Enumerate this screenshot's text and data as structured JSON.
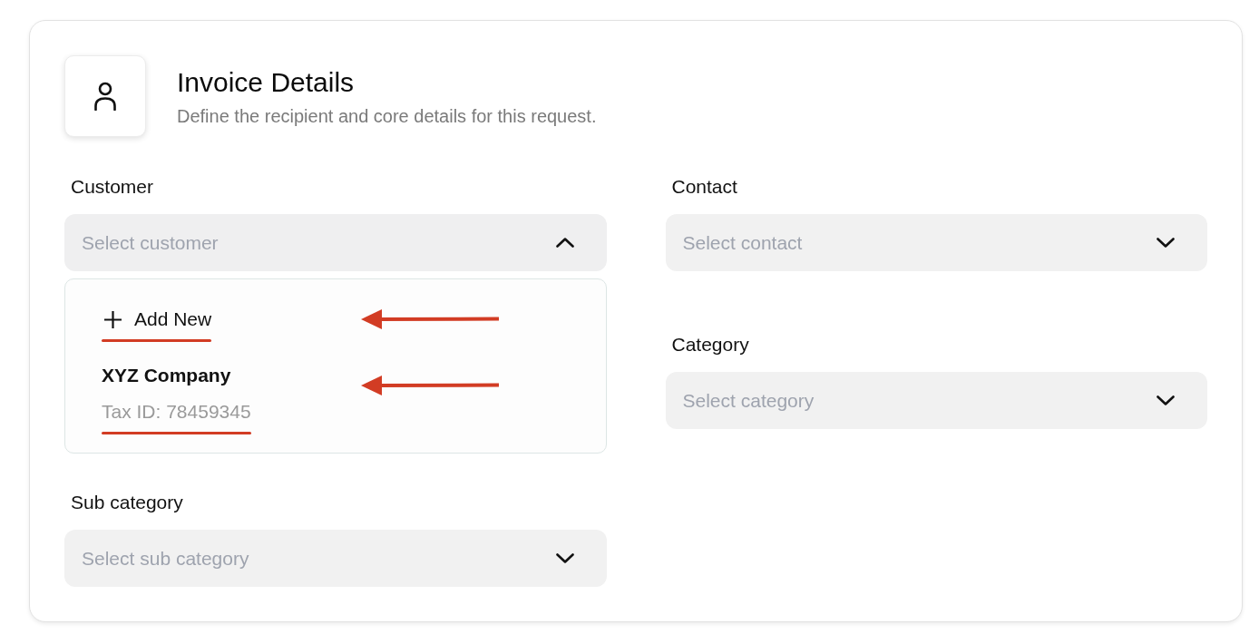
{
  "header": {
    "title": "Invoice Details",
    "subtitle": "Define the recipient and core details for this request."
  },
  "form": {
    "left_column": [
      {
        "label": "Customer",
        "placeholder": "Select customer",
        "expanded": true,
        "options": [
          {
            "kind": "action",
            "label": "Add New",
            "annotated": true
          },
          {
            "kind": "entry",
            "name": "XYZ Company",
            "detail": "Tax ID: 78459345",
            "annotated": true
          }
        ]
      },
      {
        "label": "Sub category",
        "placeholder": "Select sub category",
        "expanded": false
      }
    ],
    "right_column": [
      {
        "label": "Contact",
        "placeholder": "Select contact",
        "expanded": false
      },
      {
        "label": "Category",
        "placeholder": "Select category",
        "expanded": false
      }
    ]
  }
}
